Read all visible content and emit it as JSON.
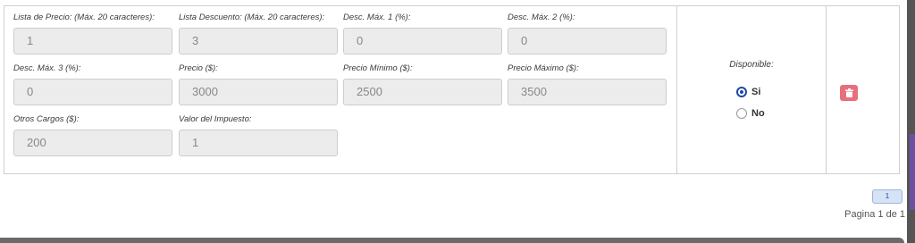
{
  "fields": [
    {
      "label": "Lista de Precio: (Máx. 20 caracteres):",
      "value": "1"
    },
    {
      "label": "Lista Descuento: (Máx. 20 caracteres):",
      "value": "3"
    },
    {
      "label": "Desc. Máx. 1 (%):",
      "value": "0"
    },
    {
      "label": "Desc. Máx. 2 (%):",
      "value": "0"
    },
    {
      "label": "Desc. Máx. 3 (%):",
      "value": "0"
    },
    {
      "label": "Precio ($):",
      "value": "3000"
    },
    {
      "label": "Precio Mínimo ($):",
      "value": "2500"
    },
    {
      "label": "Precio Máximo ($):",
      "value": "3500"
    },
    {
      "label": "Otros Cargos ($):",
      "value": "200"
    },
    {
      "label": "Valor del Impuesto:",
      "value": "1"
    }
  ],
  "availability": {
    "title": "Disponible:",
    "options": [
      {
        "label": "Si",
        "checked": true
      },
      {
        "label": "No",
        "checked": false
      }
    ]
  },
  "actions": {
    "delete_icon": "trash-icon",
    "delete_color": "#e7707c"
  },
  "pagination": {
    "current_page": "1",
    "summary": "Pagina 1 de 1"
  },
  "colors": {
    "accent": "#1f47a8",
    "input_bg": "#ececec"
  }
}
